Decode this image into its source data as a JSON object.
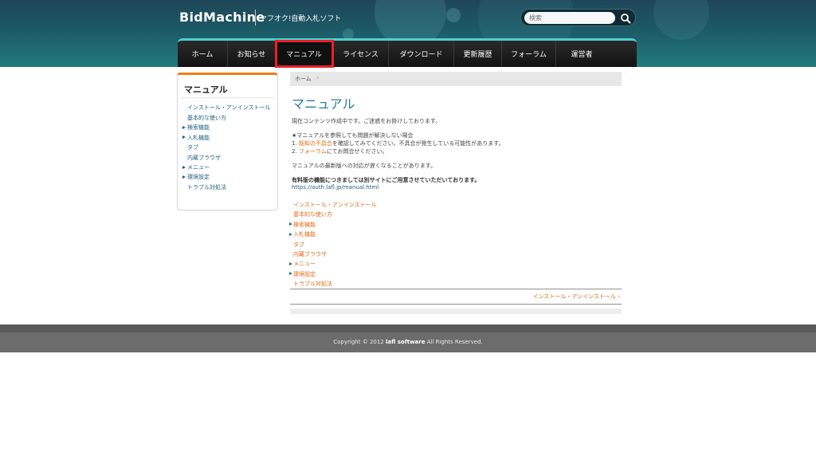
{
  "header": {
    "logo": "BidMachine",
    "tagline": "ヤフオク!自動入札ソフト",
    "search_placeholder": "検索"
  },
  "nav": {
    "items": [
      {
        "label": "ホーム"
      },
      {
        "label": "お知らせ"
      },
      {
        "label": "マニュアル",
        "active": true
      },
      {
        "label": "ライセンス"
      },
      {
        "label": "ダウンロード"
      },
      {
        "label": "更新履歴"
      },
      {
        "label": "フォーラム"
      },
      {
        "label": "運営者"
      }
    ]
  },
  "sidebar": {
    "title": "マニュアル",
    "items": [
      {
        "label": "インストール・アンインストール"
      },
      {
        "label": "基本的な使い方"
      },
      {
        "label": "検索機能",
        "arrow": true
      },
      {
        "label": "入札機能",
        "arrow": true
      },
      {
        "label": "タブ"
      },
      {
        "label": "内蔵ブラウザ"
      },
      {
        "label": "メニュー",
        "arrow": true
      },
      {
        "label": "環境設定",
        "arrow": true
      },
      {
        "label": "トラブル対処法"
      }
    ]
  },
  "breadcrumb": {
    "home": "ホーム",
    "arrow": "›"
  },
  "main": {
    "title": "マニュアル",
    "intro": "現在コンテンツ作成中です。ご迷惑をお掛けしております。",
    "notice_heading": "★マニュアルを参照しても問題が解決しない場合",
    "step1_num": "1.",
    "step1_link": "既知の不具合",
    "step1_text": "を確認してみてください。不具合が発生している可能性があります。",
    "step2_num": "2.",
    "step2_link": "フォーラム",
    "step2_text": "にてお問合せください。",
    "delay_note": "マニュアルの最新版への対応が遅くなることがあります。",
    "paid_note": "有料版の機能につきましては別サイトにご用意させていただいております。",
    "paid_url": "https://auth.lafl.jp/manual.html",
    "links": [
      {
        "label": "インストール・アンインストール"
      },
      {
        "label": "基本的な使い方"
      },
      {
        "label": "検索機能",
        "arrow": true
      },
      {
        "label": "入札機能",
        "arrow": true
      },
      {
        "label": "タブ"
      },
      {
        "label": "内蔵ブラウザ"
      },
      {
        "label": "メニュー",
        "arrow": true
      },
      {
        "label": "環境設定",
        "arrow": true
      },
      {
        "label": "トラブル対処法"
      }
    ],
    "next_link": "インストール・アンインストール ›"
  },
  "footer": {
    "copyright_prefix": "Copyright © 2012",
    "brand": "lafl software",
    "copyright_suffix": "All Rights Reserved."
  },
  "colors": {
    "accent_orange": "#e46a12",
    "nav_highlight": "#e8202a",
    "title_blue": "#2a7d9a"
  }
}
